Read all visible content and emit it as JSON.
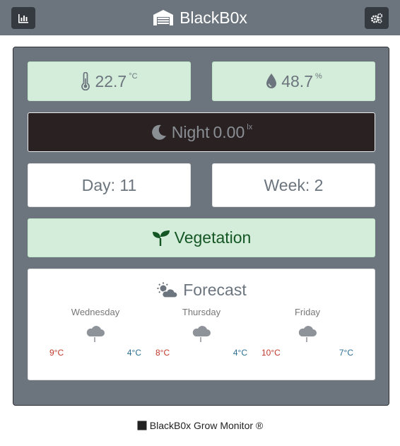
{
  "header": {
    "brand": "BlackB0x",
    "stats_icon": "bar-chart-icon",
    "settings_icon": "gears-icon",
    "logo_icon": "warehouse-icon"
  },
  "sensors": {
    "temperature": {
      "value": "22.7",
      "unit": "°C",
      "icon": "thermometer-icon"
    },
    "humidity": {
      "value": "48.7",
      "unit": "%",
      "icon": "droplet-icon"
    },
    "light": {
      "mode": "Night",
      "value": "0.00",
      "unit": "lx",
      "icon": "moon-icon"
    }
  },
  "grow": {
    "day": "Day: 11",
    "week": "Week: 2",
    "phase": "Vegetation",
    "phase_icon": "seedling-icon"
  },
  "forecast": {
    "title": "Forecast",
    "icon": "cloud-sun-icon",
    "days": [
      {
        "name": "Wednesday",
        "high": "9°C",
        "low": "4°C",
        "icon": "cloud-rain-icon"
      },
      {
        "name": "Thursday",
        "high": "8°C",
        "low": "4°C",
        "icon": "cloud-rain-icon"
      },
      {
        "name": "Friday",
        "high": "10°C",
        "low": "7°C",
        "icon": "cloud-rain-icon"
      }
    ]
  },
  "footer": {
    "text": "BlackB0x Grow Monitor ®",
    "icon": "square-icon"
  },
  "colors": {
    "header_bg": "#6c757d",
    "button_bg": "#343a40",
    "success_bg": "#d4edda",
    "success_text": "#155724",
    "night_bg": "#2a2123",
    "high_temp": "#c0392b",
    "low_temp": "#2d6f93"
  }
}
